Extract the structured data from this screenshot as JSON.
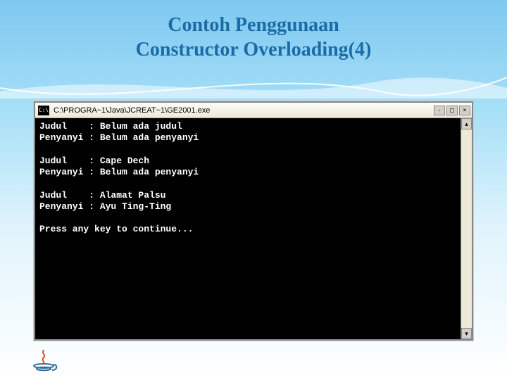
{
  "slide": {
    "title_line1": "Contoh Penggunaan",
    "title_line2": "Constructor Overloading(4)"
  },
  "console": {
    "titlebar_icon_text": "C:\\",
    "titlebar_text": "C:\\PROGRA~1\\Java\\JCREAT~1\\GE2001.exe",
    "minimize_label": "-",
    "maximize_label": "□",
    "close_label": "×",
    "scroll_up_label": "▴",
    "scroll_down_label": "▾",
    "output": "Judul    : Belum ada judul\nPenyanyi : Belum ada penyanyi\n\nJudul    : Cape Dech\nPenyanyi : Belum ada penyanyi\n\nJudul    : Alamat Palsu\nPenyanyi : Ayu Ting-Ting\n\nPress any key to continue..."
  },
  "logo": {
    "name": "java-logo"
  }
}
